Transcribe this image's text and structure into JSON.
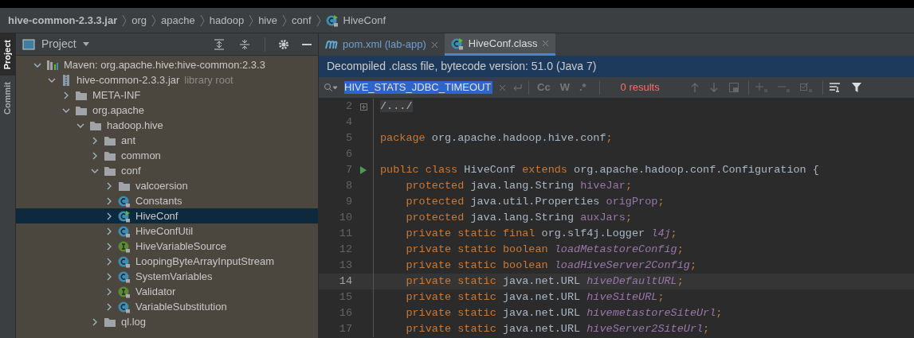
{
  "breadcrumb": [
    {
      "label": "hive-common-2.3.3.jar",
      "bold": true
    },
    {
      "label": "org",
      "bold": false
    },
    {
      "label": "apache",
      "bold": false
    },
    {
      "label": "hadoop",
      "bold": false
    },
    {
      "label": "hive",
      "bold": false
    },
    {
      "label": "conf",
      "bold": false
    },
    {
      "label": "HiveConf",
      "bold": false,
      "kind": "class"
    }
  ],
  "side_tabs": [
    {
      "label": "Project",
      "selected": true
    },
    {
      "label": "Commit",
      "selected": false
    }
  ],
  "project_panel": {
    "title": "Project"
  },
  "tree": [
    {
      "label": "Maven: org.apache.hive:hive-common:2.3.3",
      "kind": "library",
      "expanded": true,
      "selected": false,
      "children": [
        {
          "label": "hive-common-2.3.3.jar",
          "suffix": "library root",
          "kind": "jar",
          "expanded": true,
          "selected": false,
          "children": [
            {
              "label": "META-INF",
              "kind": "folder",
              "expanded": false,
              "selected": false
            },
            {
              "label": "org.apache",
              "kind": "folder",
              "expanded": true,
              "selected": false,
              "children": [
                {
                  "label": "hadoop.hive",
                  "kind": "folder",
                  "expanded": true,
                  "selected": false,
                  "children": [
                    {
                      "label": "ant",
                      "kind": "folder",
                      "expanded": false,
                      "selected": false
                    },
                    {
                      "label": "common",
                      "kind": "folder",
                      "expanded": false,
                      "selected": false
                    },
                    {
                      "label": "conf",
                      "kind": "folder",
                      "expanded": true,
                      "selected": false,
                      "children": [
                        {
                          "label": "valcoersion",
                          "kind": "folder",
                          "expanded": false,
                          "selected": false
                        },
                        {
                          "label": "Constants",
                          "kind": "class",
                          "expanded": false,
                          "selected": false
                        },
                        {
                          "label": "HiveConf",
                          "kind": "runnable_class",
                          "expanded": false,
                          "selected": true
                        },
                        {
                          "label": "HiveConfUtil",
                          "kind": "class",
                          "expanded": false,
                          "selected": false
                        },
                        {
                          "label": "HiveVariableSource",
                          "kind": "interface",
                          "expanded": false,
                          "selected": false
                        },
                        {
                          "label": "LoopingByteArrayInputStream",
                          "kind": "class",
                          "expanded": false,
                          "selected": false
                        },
                        {
                          "label": "SystemVariables",
                          "kind": "class",
                          "expanded": false,
                          "selected": false
                        },
                        {
                          "label": "Validator",
                          "kind": "interface",
                          "expanded": false,
                          "selected": false
                        },
                        {
                          "label": "VariableSubstitution",
                          "kind": "class",
                          "expanded": false,
                          "selected": false
                        }
                      ]
                    },
                    {
                      "label": "ql.log",
                      "kind": "folder",
                      "expanded": false,
                      "selected": false
                    }
                  ]
                }
              ]
            }
          ]
        }
      ]
    }
  ],
  "editor_tabs": [
    {
      "label": "pom.xml (lab-app)",
      "kind": "maven",
      "selected": false
    },
    {
      "label": "HiveConf.class",
      "kind": "class",
      "selected": true
    }
  ],
  "banner": "Decompiled .class file, bytecode version: 51.0 (Java 7)",
  "search": {
    "value": "HIVE_STATS_JDBC_TIMEOUT",
    "options": [
      "Cc",
      "W",
      ".*"
    ],
    "results": "0 results"
  },
  "code": [
    {
      "n": "2",
      "fold": true,
      "current": false,
      "tokens": [
        {
          "t": "/.../",
          "kind": "folded"
        }
      ]
    },
    {
      "n": "4",
      "current": false
    },
    {
      "n": "5",
      "current": false,
      "tokens": [
        {
          "t": "package ",
          "kind": "keyword"
        },
        {
          "t": "org.apache.hadoop.hive.conf",
          "kind": "plain"
        },
        {
          "t": ";",
          "kind": "keyword"
        }
      ]
    },
    {
      "n": "6",
      "current": false
    },
    {
      "n": "7",
      "run": true,
      "current": false,
      "tokens": [
        {
          "t": "public class ",
          "kind": "keyword"
        },
        {
          "t": "HiveConf ",
          "kind": "plain"
        },
        {
          "t": "extends ",
          "kind": "keyword"
        },
        {
          "t": "org.apache.hadoop.conf.Configuration {",
          "kind": "plain"
        }
      ]
    },
    {
      "n": "8",
      "current": false,
      "tokens": [
        {
          "t": "    protected ",
          "kind": "keyword"
        },
        {
          "t": "java.lang.String ",
          "kind": "plain"
        },
        {
          "t": "hiveJar",
          "kind": "field"
        },
        {
          "t": ";",
          "kind": "keyword"
        }
      ]
    },
    {
      "n": "9",
      "current": false,
      "tokens": [
        {
          "t": "    protected ",
          "kind": "keyword"
        },
        {
          "t": "java.util.Properties ",
          "kind": "plain"
        },
        {
          "t": "origProp",
          "kind": "field"
        },
        {
          "t": ";",
          "kind": "keyword"
        }
      ]
    },
    {
      "n": "10",
      "current": false,
      "tokens": [
        {
          "t": "    protected ",
          "kind": "keyword"
        },
        {
          "t": "java.lang.String ",
          "kind": "plain"
        },
        {
          "t": "auxJars",
          "kind": "field"
        },
        {
          "t": ";",
          "kind": "keyword"
        }
      ]
    },
    {
      "n": "11",
      "current": false,
      "tokens": [
        {
          "t": "    private static final ",
          "kind": "keyword"
        },
        {
          "t": "org.slf4j.Logger ",
          "kind": "plain"
        },
        {
          "t": "l4j",
          "kind": "static"
        },
        {
          "t": ";",
          "kind": "keyword"
        }
      ]
    },
    {
      "n": "12",
      "current": false,
      "tokens": [
        {
          "t": "    private static boolean ",
          "kind": "keyword"
        },
        {
          "t": "loadMetastoreConfig",
          "kind": "static"
        },
        {
          "t": ";",
          "kind": "keyword"
        }
      ]
    },
    {
      "n": "13",
      "current": false,
      "tokens": [
        {
          "t": "    private static boolean ",
          "kind": "keyword"
        },
        {
          "t": "loadHiveServer2Config",
          "kind": "static"
        },
        {
          "t": ";",
          "kind": "keyword"
        }
      ]
    },
    {
      "n": "14",
      "current": true,
      "tokens": [
        {
          "t": "    private static ",
          "kind": "keyword"
        },
        {
          "t": "java.net.URL ",
          "kind": "plain"
        },
        {
          "t": "hiveDefaultURL",
          "kind": "static"
        },
        {
          "t": ";",
          "kind": "keyword"
        }
      ]
    },
    {
      "n": "15",
      "current": false,
      "tokens": [
        {
          "t": "    private static ",
          "kind": "keyword"
        },
        {
          "t": "java.net.URL ",
          "kind": "plain"
        },
        {
          "t": "hiveSiteURL",
          "kind": "static"
        },
        {
          "t": ";",
          "kind": "keyword"
        }
      ]
    },
    {
      "n": "16",
      "current": false,
      "tokens": [
        {
          "t": "    private static ",
          "kind": "keyword"
        },
        {
          "t": "java.net.URL ",
          "kind": "plain"
        },
        {
          "t": "hivemetastoreSiteUrl",
          "kind": "static"
        },
        {
          "t": ";",
          "kind": "keyword"
        }
      ]
    },
    {
      "n": "17",
      "current": false,
      "tokens": [
        {
          "t": "    private static ",
          "kind": "keyword"
        },
        {
          "t": "java.net.URL ",
          "kind": "plain"
        },
        {
          "t": "hiveServer2SiteUrl",
          "kind": "static"
        },
        {
          "t": ";",
          "kind": "keyword"
        }
      ]
    }
  ]
}
